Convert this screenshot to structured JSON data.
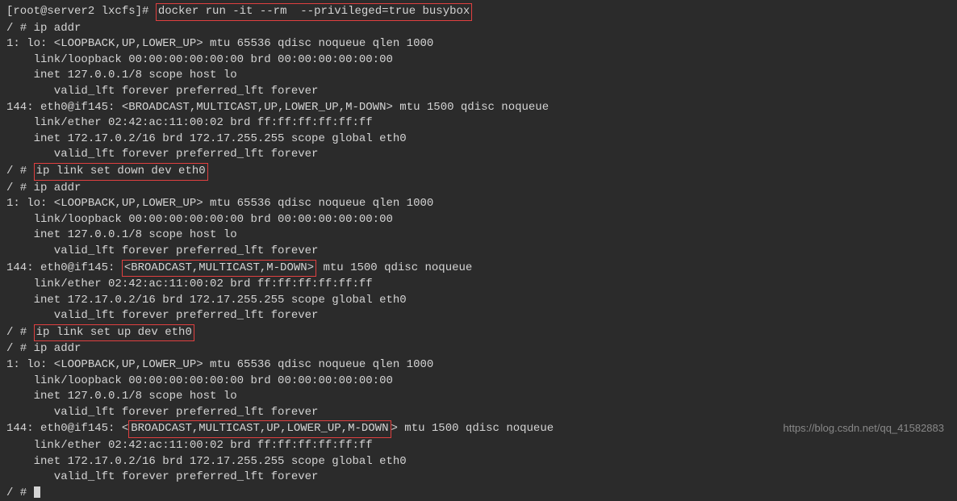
{
  "lines": {
    "l0_prefix": "[root@server2 lxcfs]# ",
    "l0_cmd": "docker run -it --rm  --privileged=true busybox",
    "l1": "/ # ip addr",
    "l2": "1: lo: <LOOPBACK,UP,LOWER_UP> mtu 65536 qdisc noqueue qlen 1000",
    "l3": "    link/loopback 00:00:00:00:00:00 brd 00:00:00:00:00:00",
    "l4": "    inet 127.0.0.1/8 scope host lo",
    "l5": "       valid_lft forever preferred_lft forever",
    "l6": "144: eth0@if145: <BROADCAST,MULTICAST,UP,LOWER_UP,M-DOWN> mtu 1500 qdisc noqueue ",
    "l7": "    link/ether 02:42:ac:11:00:02 brd ff:ff:ff:ff:ff:ff",
    "l8": "    inet 172.17.0.2/16 brd 172.17.255.255 scope global eth0",
    "l9": "       valid_lft forever preferred_lft forever",
    "l10_prefix": "/ # ",
    "l10_cmd": "ip link set down dev eth0",
    "l11": "/ # ip addr",
    "l12": "1: lo: <LOOPBACK,UP,LOWER_UP> mtu 65536 qdisc noqueue qlen 1000",
    "l13": "    link/loopback 00:00:00:00:00:00 brd 00:00:00:00:00:00",
    "l14": "    inet 127.0.0.1/8 scope host lo",
    "l15": "       valid_lft forever preferred_lft forever",
    "l16_prefix": "144: eth0@if145: ",
    "l16_box": "<BROADCAST,MULTICAST,M-DOWN>",
    "l16_suffix": " mtu 1500 qdisc noqueue ",
    "l17": "    link/ether 02:42:ac:11:00:02 brd ff:ff:ff:ff:ff:ff",
    "l18": "    inet 172.17.0.2/16 brd 172.17.255.255 scope global eth0",
    "l19": "       valid_lft forever preferred_lft forever",
    "l20_prefix": "/ # ",
    "l20_cmd": "ip link set up dev eth0",
    "l21": "/ # ip addr",
    "l22": "1: lo: <LOOPBACK,UP,LOWER_UP> mtu 65536 qdisc noqueue qlen 1000",
    "l23": "    link/loopback 00:00:00:00:00:00 brd 00:00:00:00:00:00",
    "l24": "    inet 127.0.0.1/8 scope host lo",
    "l25": "       valid_lft forever preferred_lft forever",
    "l26_prefix": "144: eth0@if145: <",
    "l26_box": "BROADCAST,MULTICAST,UP,LOWER_UP,M-DOWN",
    "l26_suffix": "> mtu 1500 qdisc noqueue ",
    "l27": "    link/ether 02:42:ac:11:00:02 brd ff:ff:ff:ff:ff:ff",
    "l28": "    inet 172.17.0.2/16 brd 172.17.255.255 scope global eth0",
    "l29": "       valid_lft forever preferred_lft forever",
    "l30": "/ # "
  },
  "watermark": "https://blog.csdn.net/qq_41582883"
}
